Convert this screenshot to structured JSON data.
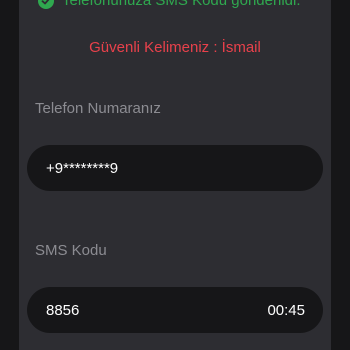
{
  "notice": {
    "sent_text": "Telefonunuza SMS Kodu gönderildi.",
    "icon": "check-circle-icon",
    "color": "#2fa84f"
  },
  "security": {
    "text": "Güvenli Kelimeniz : İsmail",
    "color": "#e8414b"
  },
  "phone": {
    "label": "Telefon Numaranız",
    "value": "+9********9"
  },
  "sms": {
    "label": "SMS Kodu",
    "value": "8856",
    "timer": "00:45"
  }
}
